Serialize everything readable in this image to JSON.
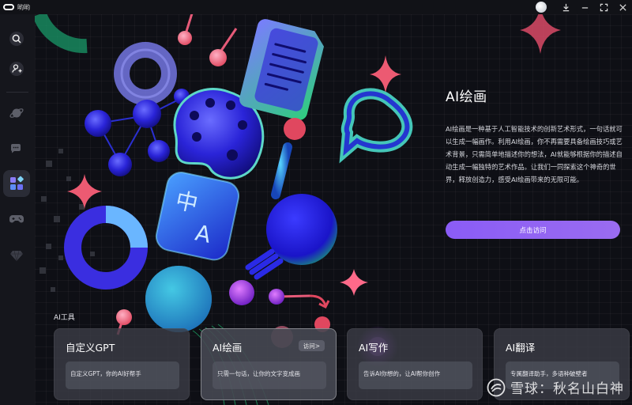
{
  "app": {
    "name": "哟哟"
  },
  "info": {
    "title": "AI绘画",
    "description": "AI绘画是一种基于人工智能技术的创新艺术形式，一句话就可以生成一幅画作。利用AI绘画，你不再需要具备绘画技巧或艺术背景，只需简单地描述你的想法，AI就能够根据你的描述自动生成一幅独特的艺术作品。让我们一同探索这个神奇的世界，释放创造力，感受AI绘画带来的无限可能。",
    "button_label": "点击访问"
  },
  "tools": {
    "section_label": "AI工具",
    "cards": [
      {
        "title": "自定义GPT",
        "desc": "自定义GPT，你的AI好帮手"
      },
      {
        "title": "AI绘画",
        "desc": "只需一句话，让你的文字变成画",
        "visit_label": "访问>"
      },
      {
        "title": "AI写作",
        "desc": "告诉AI你想的，让AI帮你创作"
      },
      {
        "title": "AI翻译",
        "desc": "专属翻译助手，多语种破壁者"
      }
    ]
  },
  "watermark": {
    "text": "雪球：秋名山白神"
  },
  "colors": {
    "accent": "#8a5cf6",
    "sidebar": "#15161c",
    "background": "#0e0f15"
  },
  "icons": {
    "sidebar": [
      "search-icon",
      "add-user-icon",
      "planet-icon",
      "chat-icon",
      "apps-icon",
      "gamepad-icon",
      "gem-icon"
    ],
    "topbar": [
      "avatar",
      "download-icon",
      "minimize-icon",
      "fullscreen-icon",
      "close-icon"
    ]
  }
}
